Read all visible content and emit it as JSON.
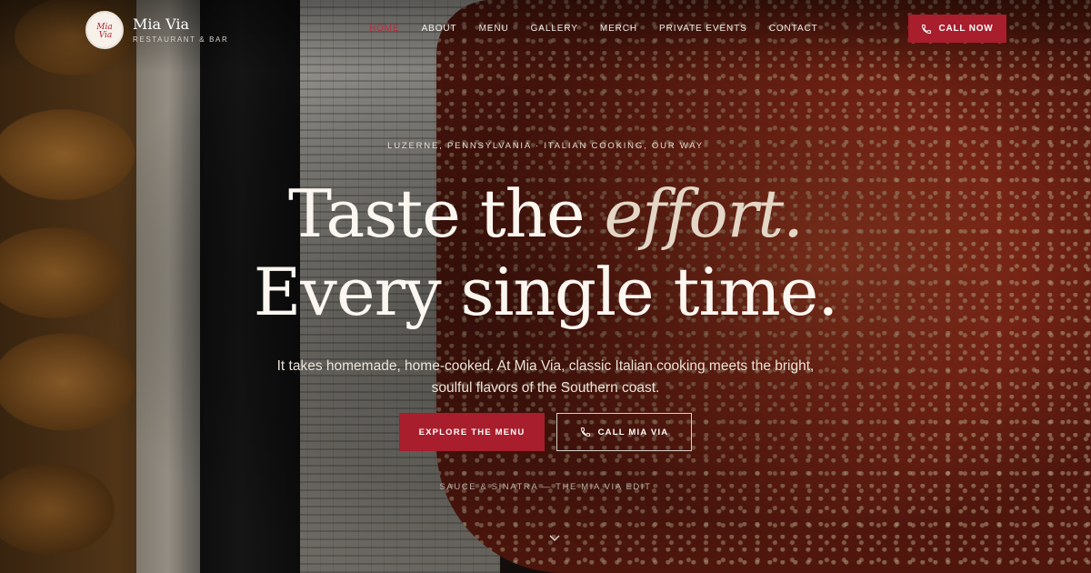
{
  "brand": {
    "name": "Mia Via",
    "subtitle": "RESTAURANT & BAR",
    "logo_script": "Mia Via"
  },
  "nav": {
    "items": [
      {
        "label": "HOME",
        "active": true
      },
      {
        "label": "ABOUT",
        "active": false
      },
      {
        "label": "MENU",
        "active": false
      },
      {
        "label": "GALLERY",
        "active": false
      },
      {
        "label": "MERCH",
        "active": false
      },
      {
        "label": "PRIVATE EVENTS",
        "active": false
      },
      {
        "label": "CONTACT",
        "active": false
      }
    ],
    "cta_label": "CALL NOW",
    "cta_icon": "phone-icon"
  },
  "hero": {
    "eyebrow": "LUZERNE, PENNSYLVANIA · ITALIAN COOKING, OUR WAY",
    "headline_line1_plain": "Taste the ",
    "headline_line1_em": "effort.",
    "headline_line2": "Every single time.",
    "lede": "It takes homemade, home-cooked. At Mia Via, classic Italian cooking meets the bright, soulful flavors of the Southern coast.",
    "primary_button": "EXPLORE THE MENU",
    "secondary_button": "CALL MIA VIA",
    "secondary_icon": "phone-icon",
    "tagline": "SAUCE & SINATRA — THE MIA VIA EDIT",
    "scroll_icon": "chevron-down-icon"
  },
  "colors": {
    "accent": "#a81e2c",
    "active_nav": "#c8283a",
    "text_light": "#fbf6f0"
  }
}
